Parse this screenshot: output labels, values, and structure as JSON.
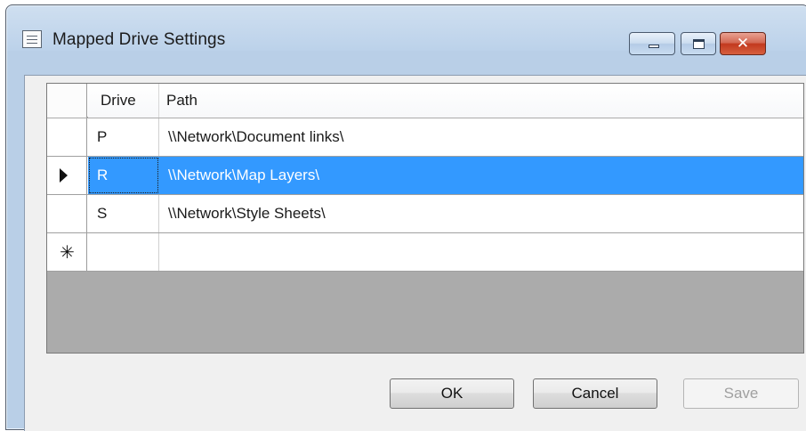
{
  "window": {
    "title": "Mapped Drive Settings",
    "icon": "form-window-icon",
    "controls": {
      "minimize": "minimize-icon",
      "maximize": "maximize-icon",
      "close": "✕"
    }
  },
  "grid": {
    "columns": {
      "drive": "Drive",
      "path": "Path"
    },
    "rows": [
      {
        "drive": "P",
        "path": "\\\\Network\\Document links\\",
        "selected": false
      },
      {
        "drive": "R",
        "path": "\\\\Network\\Map Layers\\",
        "selected": true
      },
      {
        "drive": "S",
        "path": "\\\\Network\\Style Sheets\\",
        "selected": false
      }
    ],
    "new_row_marker": "✳",
    "current_row_marker": "row-pointer-icon"
  },
  "buttons": {
    "ok": "OK",
    "cancel": "Cancel",
    "save": "Save",
    "save_enabled": false
  },
  "colors": {
    "selection": "#3399ff",
    "selection_text": "#ffffff",
    "close_button": "#c2391e"
  }
}
